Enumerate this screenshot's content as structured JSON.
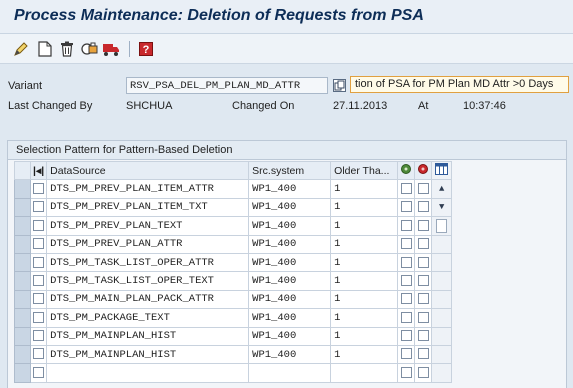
{
  "window": {
    "title": "Process Maintenance: Deletion of Requests from PSA"
  },
  "toolbar": {
    "icons": [
      "pencil-icon",
      "new-document-icon",
      "delete-icon",
      "copy-print-icon",
      "transport-icon",
      "help-icon"
    ]
  },
  "form": {
    "variant_label": "Variant",
    "variant_value": "RSV_PSA_DEL_PM_PLAN_MD_ATTR",
    "variant_desc": "tion of PSA for PM Plan MD Attr >0 Days",
    "last_changed_by_label": "Last Changed By",
    "last_changed_by_value": "SHCHUA",
    "changed_on_label": "Changed On",
    "changed_on_value": "27.11.2013",
    "at_label": "At",
    "at_value": "10:37:46"
  },
  "grid": {
    "title": "Selection Pattern for Pattern-Based Deletion",
    "columns": {
      "datasource": "DataSource",
      "src_system": "Src.system",
      "older_than": "Older Tha..."
    },
    "rows": [
      {
        "datasource": "DTS_PM_PREV_PLAN_ITEM_ATTR",
        "src_system": "WP1_400",
        "older_than": "1"
      },
      {
        "datasource": "DTS_PM_PREV_PLAN_ITEM_TXT",
        "src_system": "WP1_400",
        "older_than": "1"
      },
      {
        "datasource": "DTS_PM_PREV_PLAN_TEXT",
        "src_system": "WP1_400",
        "older_than": "1"
      },
      {
        "datasource": "DTS_PM_PREV_PLAN_ATTR",
        "src_system": "WP1_400",
        "older_than": "1"
      },
      {
        "datasource": "DTS_PM_TASK_LIST_OPER_ATTR",
        "src_system": "WP1_400",
        "older_than": "1"
      },
      {
        "datasource": "DTS_PM_TASK_LIST_OPER_TEXT",
        "src_system": "WP1_400",
        "older_than": "1"
      },
      {
        "datasource": "DTS_PM_MAIN_PLAN_PACK_ATTR",
        "src_system": "WP1_400",
        "older_than": "1"
      },
      {
        "datasource": "DTS_PM_PACKAGE_TEXT",
        "src_system": "WP1_400",
        "older_than": "1"
      },
      {
        "datasource": "DTS_PM_MAINPLAN_HIST",
        "src_system": "WP1_400",
        "older_than": "1"
      },
      {
        "datasource": "DTS_PM_MAINPLAN_HIST",
        "src_system": "WP1_400",
        "older_than": "1"
      },
      {
        "datasource": "",
        "src_system": "",
        "older_than": ""
      }
    ]
  }
}
